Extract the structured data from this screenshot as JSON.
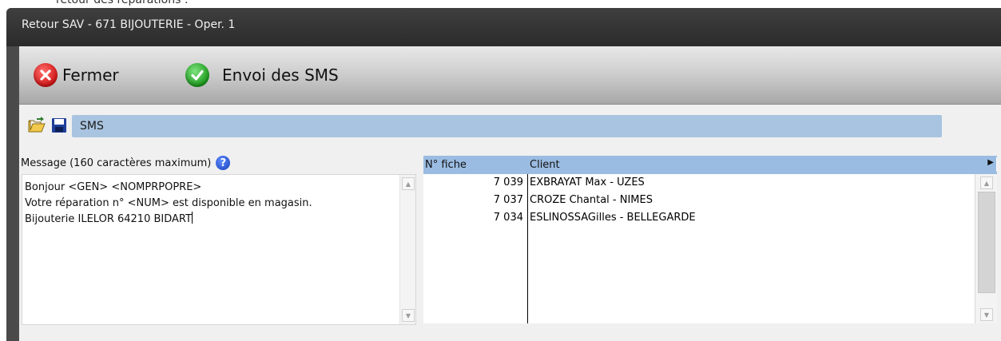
{
  "background_window": {
    "title": "retour des réparations :"
  },
  "window": {
    "title": "Retour SAV - 671 BIJOUTERIE - Oper. 1"
  },
  "toolbar": {
    "close_label": "Fermer",
    "send_label": "Envoi des SMS"
  },
  "panel": {
    "title": "SMS"
  },
  "message": {
    "label": "Message (160 caractères maximum)",
    "help_icon": "?",
    "text": "Bonjour <GEN> <NOMPRPOPRE>\nVotre réparation n° <NUM> est disponible en magasin.\nBijouterie ILELOR 64210 BIDART"
  },
  "table": {
    "columns": [
      "N° fiche",
      "Client"
    ],
    "rows": [
      {
        "num": "7 039",
        "client": "EXBRAYAT Max - UZES"
      },
      {
        "num": "7 037",
        "client": "CROZE Chantal - NIMES"
      },
      {
        "num": "7 034",
        "client": "ESLINOSSAGilles - BELLEGARDE"
      }
    ]
  },
  "colors": {
    "panel_blue": "#a9c4e0",
    "header_blue": "#9bbce2",
    "close_red": "#d21616",
    "send_green": "#1e9b1e"
  }
}
